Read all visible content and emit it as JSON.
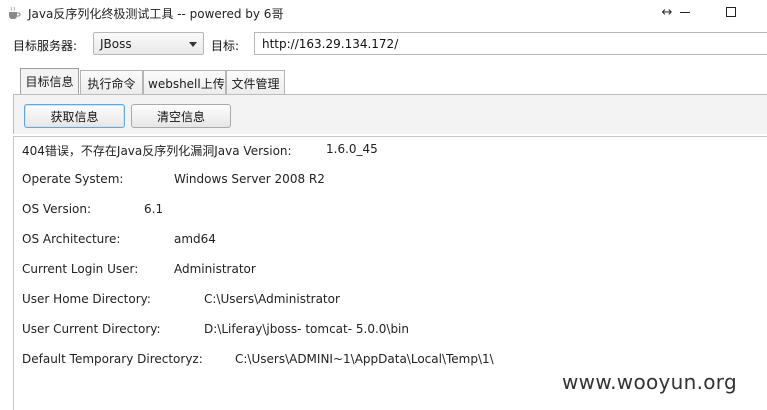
{
  "window": {
    "title": "Java反序列化终极测试工具  -- powered by 6哥",
    "app_icon": "coffee-cup-icon",
    "resize_icon": "↔"
  },
  "server": {
    "label": "目标服务器:",
    "selected": "JBoss"
  },
  "target": {
    "label": "目标:",
    "value": "http://163.29.134.172/"
  },
  "tabs": [
    {
      "label": "目标信息",
      "active": true
    },
    {
      "label": "执行命令",
      "active": false
    },
    {
      "label": "webshell上传",
      "active": false
    },
    {
      "label": "文件管理",
      "active": false
    }
  ],
  "buttons": {
    "fetch": "获取信息",
    "clear": "清空信息"
  },
  "output": {
    "line0_prefix": "404错误，不存在Java反序列化漏洞Java Version:",
    "line0_value": "1.6.0_45",
    "rows": [
      {
        "key": "Operate System:",
        "value": "Windows Server 2008 R2"
      },
      {
        "key": "OS Version:",
        "value": "6.1"
      },
      {
        "key": "OS Architecture:",
        "value": "amd64"
      },
      {
        "key": "Current Login User:",
        "value": "Administrator"
      },
      {
        "key": "User Home Directory:",
        "value": "C:\\Users\\Administrator"
      },
      {
        "key": "User Current Directory:",
        "value": "D:\\Liferay\\jboss- tomcat- 5.0.0\\bin"
      },
      {
        "key": "Default Temporary Directoryz:",
        "value": "C:\\Users\\ADMINI~1\\AppData\\Local\\Temp\\1\\"
      }
    ]
  },
  "watermark": "www.wooyun.org"
}
